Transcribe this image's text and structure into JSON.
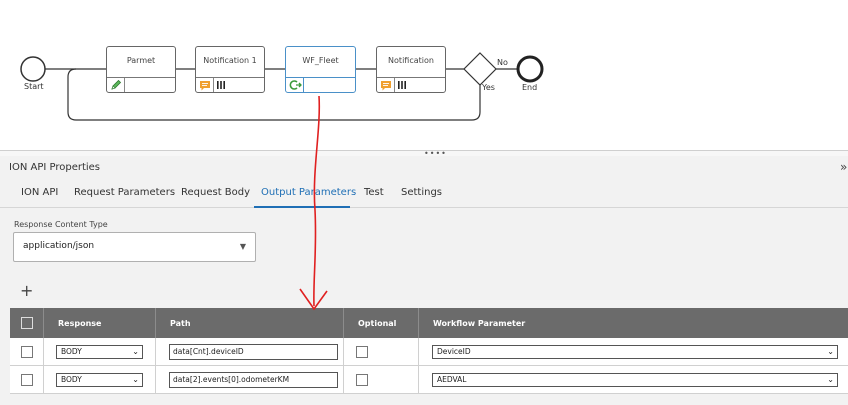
{
  "workflow": {
    "start_label": "Start",
    "end_label": "End",
    "decision_yes": "Yes",
    "decision_no": "No",
    "tasks": [
      {
        "title": "Parmet",
        "icon": "pencil-icon"
      },
      {
        "title": "Notification 1",
        "icon": "notification-icon"
      },
      {
        "title": "WF_Fleet",
        "icon": "ion-api-icon"
      },
      {
        "title": "Notification",
        "icon": "notification-icon"
      }
    ]
  },
  "panel": {
    "title": "ION API Properties",
    "collapse_glyph": "»",
    "tabs": [
      {
        "label": "ION API"
      },
      {
        "label": "Request Parameters"
      },
      {
        "label": "Request Body"
      },
      {
        "label": "Output Parameters",
        "active": true
      },
      {
        "label": "Test"
      },
      {
        "label": "Settings"
      }
    ],
    "response_content_type": {
      "label": "Response Content Type",
      "value": "application/json"
    },
    "add_glyph": "+",
    "table": {
      "columns": [
        "Response",
        "Path",
        "Optional",
        "Workflow Parameter"
      ],
      "rows": [
        {
          "response": "BODY",
          "path": "data[Cnt].deviceID",
          "optional": false,
          "workflow_parameter": "DeviceID"
        },
        {
          "response": "BODY",
          "path": "data[2].events[0].odometerKM",
          "optional": false,
          "workflow_parameter": "AEDVAL"
        }
      ]
    }
  },
  "colors": {
    "accent": "#1f6fb5",
    "table_header": "#6b6b6b",
    "annotation": "#e02020",
    "notification_icon": "#f0a030",
    "edit_icon": "#3a9a3a"
  }
}
